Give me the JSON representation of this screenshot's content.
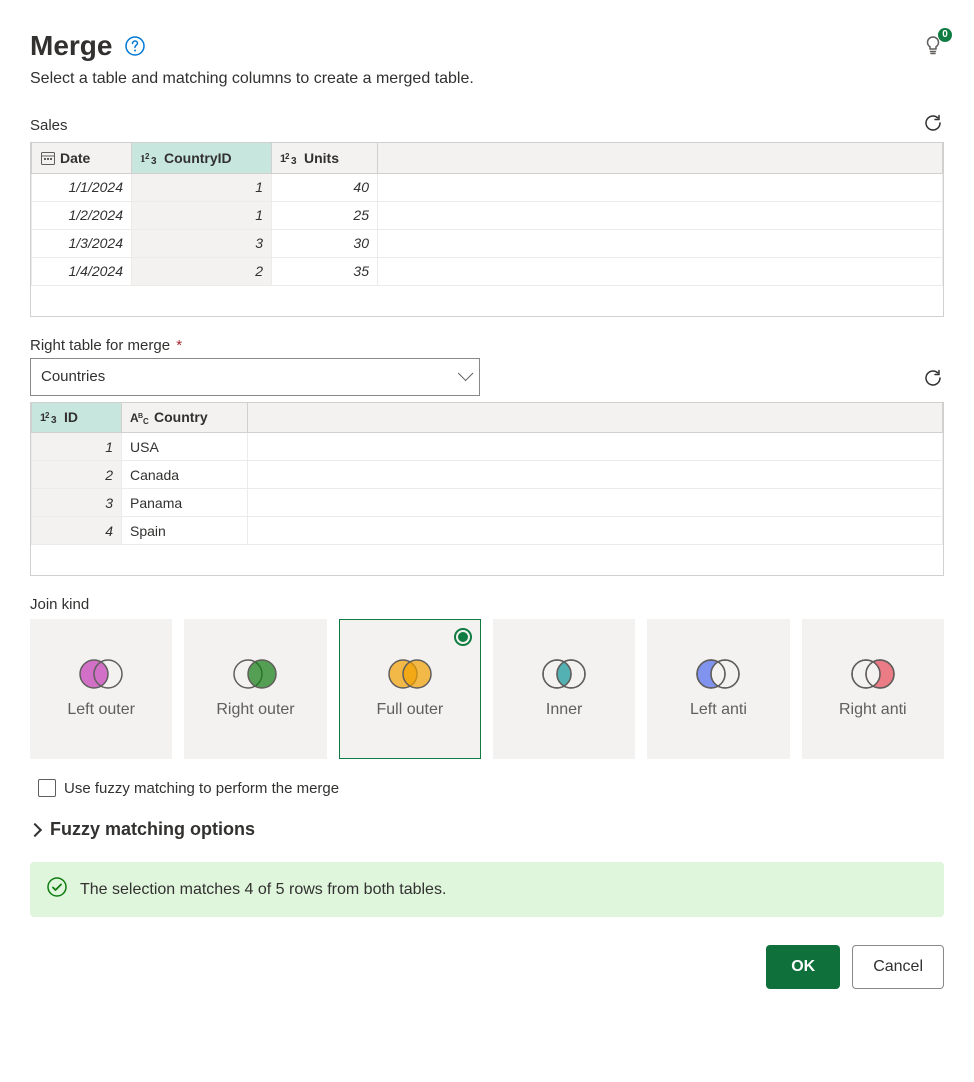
{
  "title": "Merge",
  "subtitle": "Select a table and matching columns to create a merged table.",
  "tips_badge": "0",
  "left_table": {
    "name": "Sales",
    "columns": [
      {
        "name": "Date",
        "type": "date",
        "selected": false
      },
      {
        "name": "CountryID",
        "type": "number",
        "selected": true
      },
      {
        "name": "Units",
        "type": "number",
        "selected": false
      }
    ],
    "rows": [
      {
        "Date": "1/1/2024",
        "CountryID": "1",
        "Units": "40"
      },
      {
        "Date": "1/2/2024",
        "CountryID": "1",
        "Units": "25"
      },
      {
        "Date": "1/3/2024",
        "CountryID": "3",
        "Units": "30"
      },
      {
        "Date": "1/4/2024",
        "CountryID": "2",
        "Units": "35"
      }
    ]
  },
  "right_label": "Right table for merge",
  "right_dropdown_value": "Countries",
  "right_table": {
    "columns": [
      {
        "name": "ID",
        "type": "number",
        "selected": true
      },
      {
        "name": "Country",
        "type": "text",
        "selected": false
      }
    ],
    "rows": [
      {
        "ID": "1",
        "Country": "USA"
      },
      {
        "ID": "2",
        "Country": "Canada"
      },
      {
        "ID": "3",
        "Country": "Panama"
      },
      {
        "ID": "4",
        "Country": "Spain"
      }
    ]
  },
  "join_label": "Join kind",
  "join_kinds": [
    {
      "id": "left-outer",
      "label": "Left outer"
    },
    {
      "id": "right-outer",
      "label": "Right outer"
    },
    {
      "id": "full-outer",
      "label": "Full outer",
      "selected": true
    },
    {
      "id": "inner",
      "label": "Inner"
    },
    {
      "id": "left-anti",
      "label": "Left anti"
    },
    {
      "id": "right-anti",
      "label": "Right anti"
    }
  ],
  "fuzzy_checkbox_label": "Use fuzzy matching to perform the merge",
  "fuzzy_options_label": "Fuzzy matching options",
  "status_message": "The selection matches 4 of 5 rows from both tables.",
  "ok_label": "OK",
  "cancel_label": "Cancel",
  "venn_colors": {
    "left-outer": "#c239b3",
    "right-outer": "#107c10",
    "full-outer": "#f2a100",
    "inner": "#2aa0a4",
    "left-anti": "#4f6bed",
    "right-anti": "#e74856",
    "outline": "#605e5c"
  }
}
